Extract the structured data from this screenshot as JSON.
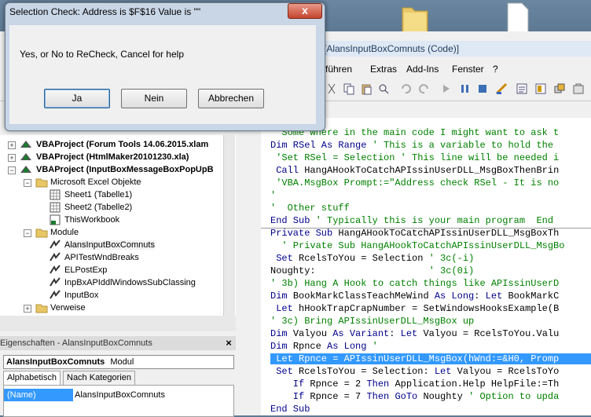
{
  "desktop": {
    "icons": [
      "folder-icon",
      "text-file-icon"
    ]
  },
  "vbe": {
    "title": "[AlansInputBoxComnuts (Code)]",
    "menu": [
      "führen",
      "Extras",
      "Add-Ins",
      "Fenster",
      "?"
    ]
  },
  "project_tree": {
    "items": [
      {
        "label": "VBAProject (Forum Tools 14.06.2015.xlam",
        "bold": true
      },
      {
        "label": "VBAProject (HtmlMaker20101230.xla)",
        "bold": true
      },
      {
        "label": "VBAProject (InputBoxMessageBoxPopUpB",
        "bold": true
      },
      {
        "label": "Microsoft Excel Objekte"
      },
      {
        "label": "Sheet1 (Tabelle1)"
      },
      {
        "label": "Sheet2 (Tabelle2)"
      },
      {
        "label": "ThisWorkbook"
      },
      {
        "label": "Module"
      },
      {
        "label": "AlansInputBoxComnuts"
      },
      {
        "label": "APITestWndBreaks"
      },
      {
        "label": "ELPostExp"
      },
      {
        "label": "InpBxAPIddlWindowsSubClassing"
      },
      {
        "label": "InputBox"
      },
      {
        "label": "Verweise"
      }
    ]
  },
  "properties": {
    "title": "Eigenschaften - AlansInputBoxComnuts",
    "combo_name": "AlansInputBoxComnuts",
    "combo_type": "Modul",
    "tabs": [
      "Alphabetisch",
      "Nach Kategorien"
    ],
    "row_name": "(Name)",
    "row_value": "AlansInputBoxComnuts"
  },
  "code": {
    "lines_top": [
      "' Some where in the main code I might want to ask t",
      "Dim RSel As Range ' This is a variable to hold the",
      " 'Set RSel = Selection ' This line will be needed i",
      " Call HangAHookToCatchAPIssinUserDLL_MsgBoxThenBrin",
      " 'VBA.MsgBox Prompt:=\"Address check RSel - It is no",
      "'",
      "'  Other stuff",
      "End Sub ' Typically this is your main program  End"
    ],
    "lines_bottom": [
      "Private Sub HangAHookToCatchAPIssinUserDLL_MsgBoxTh",
      "  ' Private Sub HangAHookToCatchAPIssinUserDLL_MsgBo",
      " Set RcelsToYou = Selection ' 3c(-i)",
      "Noughty:                    ' 3c(0i)",
      "' 3b) Hang A Hook to catch things like APIssinUserD",
      "Dim BookMarkClassTeachMeWind As Long: Let BookMarkC",
      " Let hHookTrapCrapNumber = SetWindowsHooksExample(B",
      "' 3c) Bring APIssinUserDLL_MsgBox up",
      "Dim Valyou As Variant: Let Valyou = RcelsToYou.Valu",
      "Dim Rpnce As Long '",
      " Let Rpnce = APIssinUserDLL_MsgBox(hWnd:=&H0, Promp",
      " Set RcelsToYou = Selection: Let Valyou = RcelsToYo",
      "    If Rpnce = 2 Then Application.Help HelpFile:=Th",
      "    If Rpnce = 7 Then GoTo Noughty ' Option to upda",
      "End Sub"
    ]
  },
  "dialog": {
    "title": "Selection Check: Address is $F$16  Value is \"\"",
    "close": "x",
    "message": "Yes,  or No to ReCheck, Cancel for help",
    "yes": "Ja",
    "no": "Nein",
    "cancel": "Abbrechen"
  }
}
